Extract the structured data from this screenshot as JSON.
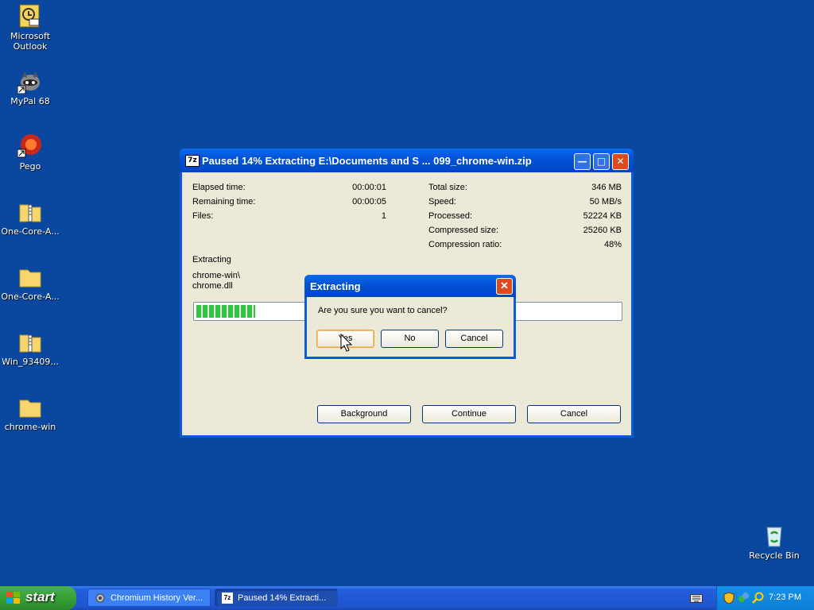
{
  "desktop": {
    "icons": [
      {
        "label": "Microsoft Outlook"
      },
      {
        "label": "MyPal 68"
      },
      {
        "label": "Pego"
      },
      {
        "label": "One-Core-A..."
      },
      {
        "label": "One-Core-A..."
      },
      {
        "label": "Win_93409..."
      },
      {
        "label": "chrome-win"
      },
      {
        "label": "Recycle Bin"
      }
    ]
  },
  "window": {
    "app_icon": "7z",
    "title": "Paused 14% Extracting E:\\Documents and S ... 099_chrome-win.zip",
    "stats_left": [
      {
        "label": "Elapsed time:",
        "value": "00:00:01"
      },
      {
        "label": "Remaining time:",
        "value": "00:00:05"
      },
      {
        "label": "Files:",
        "value": "1"
      }
    ],
    "stats_right": [
      {
        "label": "Total size:",
        "value": "346 MB"
      },
      {
        "label": "Speed:",
        "value": "50 MB/s"
      },
      {
        "label": "Processed:",
        "value": "52224 KB"
      },
      {
        "label": "Compressed size:",
        "value": "25260 KB"
      },
      {
        "label": "Compression ratio:",
        "value": "48%"
      }
    ],
    "status_label": "Extracting",
    "current_dir": "chrome-win\\",
    "current_file": "chrome.dll",
    "progress_percent": 14,
    "buttons": {
      "background": "Background",
      "continue": "Continue",
      "cancel": "Cancel"
    }
  },
  "dialog": {
    "title": "Extracting",
    "message": "Are you sure you want to cancel?",
    "yes": "Yes",
    "no": "No",
    "cancel": "Cancel"
  },
  "taskbar": {
    "start_label": "start",
    "tasks": [
      {
        "label": "Chromium History Ver..."
      },
      {
        "label": "Paused 14% Extracti..."
      }
    ],
    "clock": "7:23 PM"
  }
}
